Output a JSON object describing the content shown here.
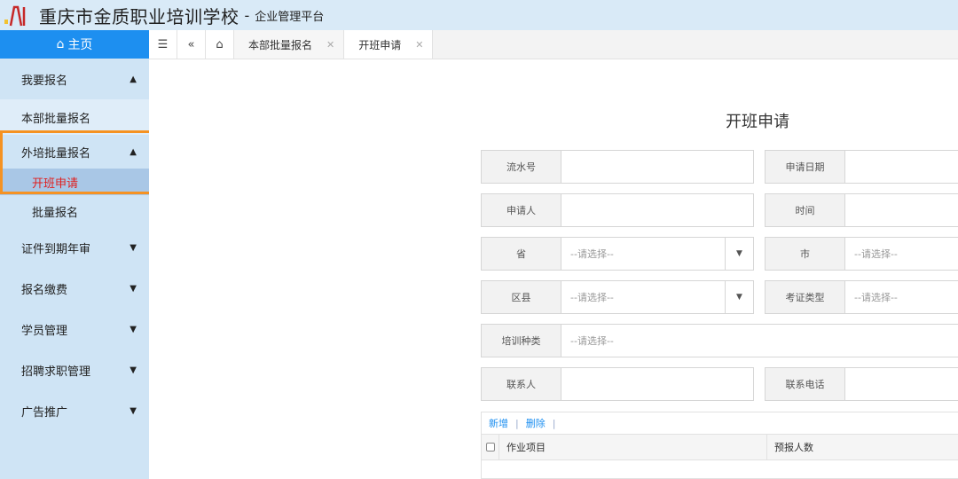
{
  "header": {
    "title": "重庆市金质职业培训学校",
    "separator": "-",
    "subtitle": "企业管理平台"
  },
  "sidebar": {
    "home_label": "主页",
    "items": [
      {
        "label": "我要报名",
        "arrow": "up"
      },
      {
        "label": "本部批量报名"
      },
      {
        "label": "外培批量报名",
        "arrow": "up"
      },
      {
        "label": "开班申请",
        "active": true
      },
      {
        "label": "批量报名"
      },
      {
        "label": "证件到期年审",
        "arrow": "down"
      },
      {
        "label": "报名缴费",
        "arrow": "down"
      },
      {
        "label": "学员管理",
        "arrow": "down"
      },
      {
        "label": "招聘求职管理",
        "arrow": "down"
      },
      {
        "label": "广告推广",
        "arrow": "down"
      }
    ]
  },
  "tabs": [
    {
      "label": "本部批量报名",
      "active": false
    },
    {
      "label": "开班申请",
      "active": true
    }
  ],
  "form": {
    "title": "开班申请",
    "fields": {
      "serial_no": {
        "label": "流水号",
        "value": ""
      },
      "apply_date": {
        "label": "申请日期",
        "value": ""
      },
      "applicant": {
        "label": "申请人",
        "value": ""
      },
      "time": {
        "label": "时间",
        "value": ""
      },
      "province": {
        "label": "省",
        "value": "--请选择--"
      },
      "city": {
        "label": "市",
        "value": "--请选择--"
      },
      "district": {
        "label": "区县",
        "value": "--请选择--"
      },
      "cert_type": {
        "label": "考证类型",
        "value": "--请选择--"
      },
      "training_type": {
        "label": "培训种类",
        "value": "--请选择--"
      },
      "contact": {
        "label": "联系人",
        "value": ""
      },
      "contact_phone": {
        "label": "联系电话",
        "value": ""
      }
    }
  },
  "table": {
    "add_label": "新增",
    "delete_label": "删除",
    "sep": "|",
    "columns": [
      "作业项目",
      "预报人数"
    ]
  },
  "colors": {
    "accent": "#1d8ff0",
    "highlight": "#f59222",
    "active_text": "#e02020"
  }
}
